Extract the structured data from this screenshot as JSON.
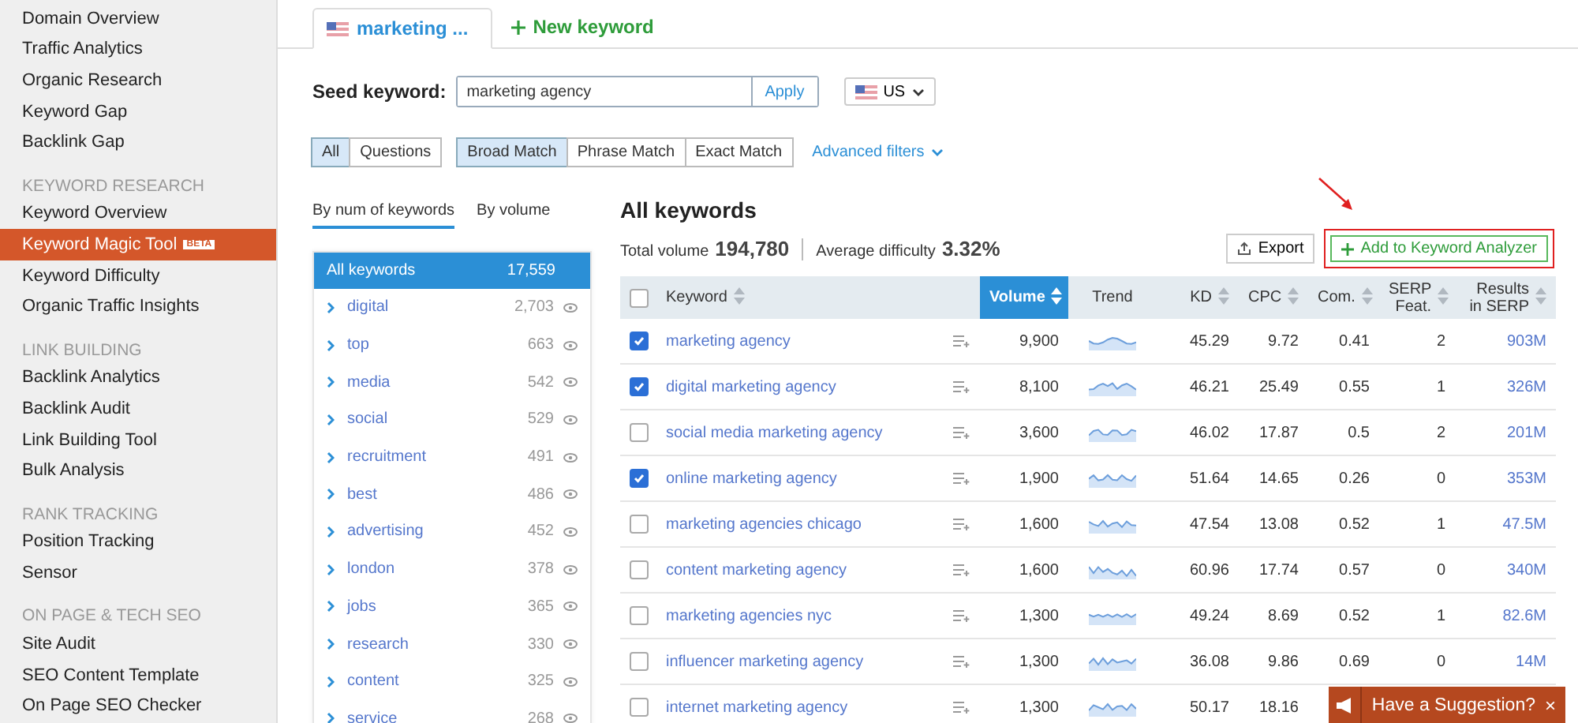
{
  "sidebar": {
    "items": [
      {
        "kind": "item",
        "label": "Domain Overview",
        "selected": false
      },
      {
        "kind": "item",
        "label": "Traffic Analytics",
        "selected": false
      },
      {
        "kind": "item",
        "label": "Organic Research",
        "selected": false
      },
      {
        "kind": "item",
        "label": "Keyword Gap",
        "selected": false
      },
      {
        "kind": "item",
        "label": "Backlink Gap",
        "selected": false
      },
      {
        "kind": "header",
        "label": "KEYWORD RESEARCH"
      },
      {
        "kind": "item",
        "label": "Keyword Overview",
        "selected": false
      },
      {
        "kind": "item",
        "label": "Keyword Magic Tool",
        "selected": true,
        "badge": "BETA"
      },
      {
        "kind": "item",
        "label": "Keyword Difficulty",
        "selected": false
      },
      {
        "kind": "item",
        "label": "Organic Traffic Insights",
        "selected": false
      },
      {
        "kind": "header",
        "label": "LINK BUILDING"
      },
      {
        "kind": "item",
        "label": "Backlink Analytics",
        "selected": false
      },
      {
        "kind": "item",
        "label": "Backlink Audit",
        "selected": false
      },
      {
        "kind": "item",
        "label": "Link Building Tool",
        "selected": false
      },
      {
        "kind": "item",
        "label": "Bulk Analysis",
        "selected": false
      },
      {
        "kind": "header",
        "label": "RANK TRACKING"
      },
      {
        "kind": "item",
        "label": "Position Tracking",
        "selected": false
      },
      {
        "kind": "item",
        "label": "Sensor",
        "selected": false
      },
      {
        "kind": "header",
        "label": "ON PAGE & TECH SEO"
      },
      {
        "kind": "item",
        "label": "Site Audit",
        "selected": false
      },
      {
        "kind": "item",
        "label": "SEO Content Template",
        "selected": false
      },
      {
        "kind": "item",
        "label": "On Page SEO Checker",
        "selected": false
      }
    ]
  },
  "tabs": [
    {
      "kind": "keyword",
      "label": "marketing ...",
      "selected": true
    },
    {
      "kind": "new",
      "label": "New keyword",
      "selected": false
    }
  ],
  "seed": {
    "label": "Seed keyword:",
    "value": "marketing agency",
    "apply": "Apply",
    "country": "US"
  },
  "filters": {
    "type": [
      {
        "label": "All",
        "selected": true
      },
      {
        "label": "Questions",
        "selected": false
      }
    ],
    "match": [
      {
        "label": "Broad Match",
        "selected": true
      },
      {
        "label": "Phrase Match",
        "selected": false
      },
      {
        "label": "Exact Match",
        "selected": false
      }
    ],
    "advanced": "Advanced filters"
  },
  "groups": {
    "tabs": [
      {
        "label": "By num of keywords",
        "selected": true
      },
      {
        "label": "By volume",
        "selected": false
      }
    ],
    "all": {
      "label": "All keywords",
      "count": "17,559"
    },
    "items": [
      {
        "label": "digital",
        "count": "2,703"
      },
      {
        "label": "top",
        "count": "663"
      },
      {
        "label": "media",
        "count": "542"
      },
      {
        "label": "social",
        "count": "529"
      },
      {
        "label": "recruitment",
        "count": "491"
      },
      {
        "label": "best",
        "count": "486"
      },
      {
        "label": "advertising",
        "count": "452"
      },
      {
        "label": "london",
        "count": "378"
      },
      {
        "label": "jobs",
        "count": "365"
      },
      {
        "label": "research",
        "count": "330"
      },
      {
        "label": "content",
        "count": "325"
      },
      {
        "label": "service",
        "count": "268"
      }
    ]
  },
  "summary": {
    "title": "All keywords",
    "total_label": "Total volume",
    "total": "194,780",
    "avg_label": "Average difficulty",
    "avg": "3.32%"
  },
  "actions": {
    "export": "Export",
    "add": "Add to Keyword Analyzer"
  },
  "table": {
    "all_checked": false,
    "columns": [
      {
        "label": "Keyword",
        "sortable": true,
        "selected": false
      },
      {
        "label": "Volume",
        "sortable": true,
        "selected": true
      },
      {
        "label": "Trend",
        "sortable": false,
        "selected": false
      },
      {
        "label": "KD",
        "sortable": true,
        "selected": false
      },
      {
        "label": "CPC",
        "sortable": true,
        "selected": false
      },
      {
        "label": "Com.",
        "sortable": true,
        "selected": false
      },
      {
        "label": "SERP Feat.",
        "sortable": true,
        "selected": false
      },
      {
        "label": "Results in SERP",
        "sortable": true,
        "selected": false
      }
    ],
    "rows": [
      {
        "checked": true,
        "keyword": "marketing agency",
        "volume": "9,900",
        "kd": "45.29",
        "cpc": "9.72",
        "com": "0.41",
        "serp": "2",
        "results": "903M"
      },
      {
        "checked": true,
        "keyword": "digital marketing agency",
        "volume": "8,100",
        "kd": "46.21",
        "cpc": "25.49",
        "com": "0.55",
        "serp": "1",
        "results": "326M"
      },
      {
        "checked": false,
        "keyword": "social media marketing agency",
        "volume": "3,600",
        "kd": "46.02",
        "cpc": "17.87",
        "com": "0.5",
        "serp": "2",
        "results": "201M"
      },
      {
        "checked": true,
        "keyword": "online marketing agency",
        "volume": "1,900",
        "kd": "51.64",
        "cpc": "14.65",
        "com": "0.26",
        "serp": "0",
        "results": "353M"
      },
      {
        "checked": false,
        "keyword": "marketing agencies chicago",
        "volume": "1,600",
        "kd": "47.54",
        "cpc": "13.08",
        "com": "0.52",
        "serp": "1",
        "results": "47.5M"
      },
      {
        "checked": false,
        "keyword": "content marketing agency",
        "volume": "1,600",
        "kd": "60.96",
        "cpc": "17.74",
        "com": "0.57",
        "serp": "0",
        "results": "340M"
      },
      {
        "checked": false,
        "keyword": "marketing agencies nyc",
        "volume": "1,300",
        "kd": "49.24",
        "cpc": "8.69",
        "com": "0.52",
        "serp": "1",
        "results": "82.6M"
      },
      {
        "checked": false,
        "keyword": "influencer marketing agency",
        "volume": "1,300",
        "kd": "36.08",
        "cpc": "9.86",
        "com": "0.69",
        "serp": "0",
        "results": "14M"
      },
      {
        "checked": false,
        "keyword": "internet marketing agency",
        "volume": "1,300",
        "kd": "50.17",
        "cpc": "18.16"
      }
    ]
  },
  "suggestion": {
    "text": "Have a Suggestion?",
    "close": "×"
  }
}
